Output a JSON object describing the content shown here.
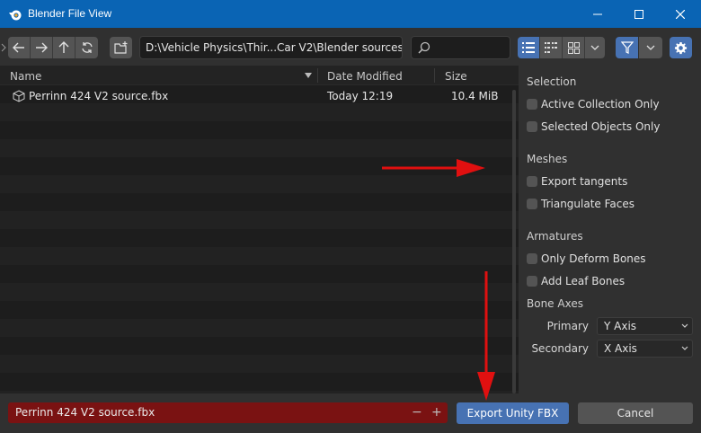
{
  "window": {
    "title": "Blender File View"
  },
  "toolbar": {
    "path": "D:\\Vehicle Physics\\Thir...Car V2\\Blender sources\\",
    "search_placeholder": ""
  },
  "filelist": {
    "columns": {
      "name": "Name",
      "date": "Date Modified",
      "size": "Size"
    },
    "files": [
      {
        "name": "Perrinn 424 V2 source.fbx",
        "date": "Today 12:19",
        "size": "10.4 MiB"
      }
    ]
  },
  "sidepanel": {
    "selection_title": "Selection",
    "active_collection": "Active Collection Only",
    "selected_objects": "Selected Objects Only",
    "meshes_title": "Meshes",
    "export_tangents": "Export tangents",
    "triangulate": "Triangulate Faces",
    "armatures_title": "Armatures",
    "only_deform": "Only Deform Bones",
    "add_leaf": "Add Leaf Bones",
    "bone_axes_title": "Bone Axes",
    "primary_label": "Primary",
    "primary_value": "Y Axis",
    "secondary_label": "Secondary",
    "secondary_value": "X Axis"
  },
  "bottom": {
    "filename": "Perrinn 424 V2 source.fbx",
    "minus": "−",
    "plus": "+",
    "export_label": "Export Unity FBX",
    "cancel_label": "Cancel"
  },
  "colors": {
    "accent": "#4772b3",
    "titlebar": "#0a64b4",
    "filename_bg": "#7a1212",
    "annotation_arrow": "#e01010"
  }
}
